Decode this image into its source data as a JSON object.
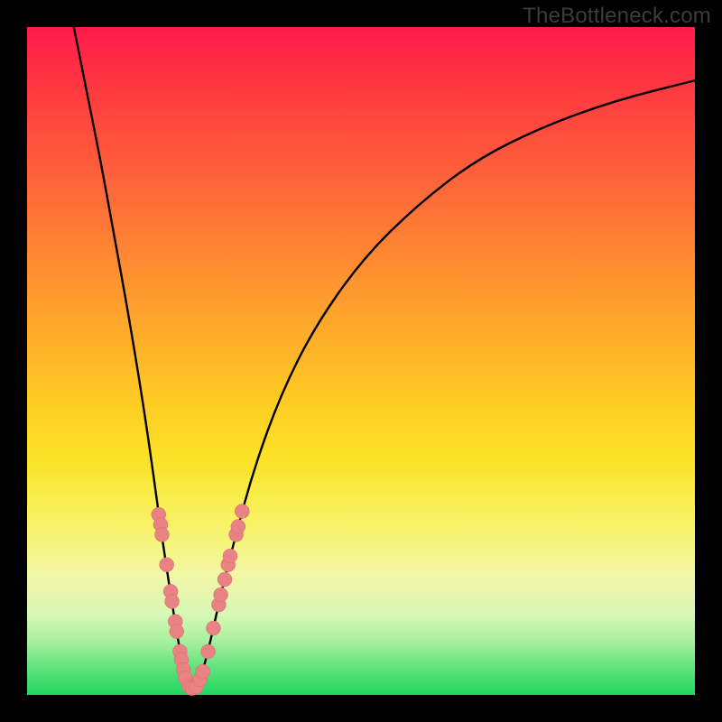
{
  "watermark": "TheBottleneck.com",
  "colors": {
    "frame": "#000000",
    "curve": "#000000",
    "marker_fill": "#e98282",
    "marker_stroke": "#d86b6b"
  },
  "chart_data": {
    "type": "line",
    "title": "",
    "xlabel": "",
    "ylabel": "",
    "xlim": [
      0,
      100
    ],
    "ylim": [
      0,
      100
    ],
    "note": "V-shaped bottleneck curve with vertex near x≈24, y≈0; gradient background red(top)→green(bottom); curve enters top-left corner and exits mid-right edge",
    "curve_points": [
      {
        "x": 7.0,
        "y": 100.0
      },
      {
        "x": 9.0,
        "y": 90.0
      },
      {
        "x": 11.0,
        "y": 80.0
      },
      {
        "x": 13.0,
        "y": 69.0
      },
      {
        "x": 15.0,
        "y": 58.0
      },
      {
        "x": 17.0,
        "y": 46.0
      },
      {
        "x": 18.5,
        "y": 36.0
      },
      {
        "x": 20.0,
        "y": 25.0
      },
      {
        "x": 21.5,
        "y": 15.0
      },
      {
        "x": 22.8,
        "y": 7.0
      },
      {
        "x": 24.0,
        "y": 1.0
      },
      {
        "x": 25.5,
        "y": 1.0
      },
      {
        "x": 27.0,
        "y": 6.0
      },
      {
        "x": 29.0,
        "y": 15.0
      },
      {
        "x": 31.0,
        "y": 23.0
      },
      {
        "x": 34.0,
        "y": 34.0
      },
      {
        "x": 38.0,
        "y": 45.0
      },
      {
        "x": 43.0,
        "y": 55.0
      },
      {
        "x": 50.0,
        "y": 65.0
      },
      {
        "x": 58.0,
        "y": 73.0
      },
      {
        "x": 67.0,
        "y": 80.0
      },
      {
        "x": 77.0,
        "y": 85.0
      },
      {
        "x": 88.0,
        "y": 89.0
      },
      {
        "x": 100.0,
        "y": 92.0
      }
    ],
    "markers": [
      {
        "x": 19.7,
        "y": 27.0
      },
      {
        "x": 20.0,
        "y": 25.5
      },
      {
        "x": 20.2,
        "y": 24.0
      },
      {
        "x": 20.9,
        "y": 19.5
      },
      {
        "x": 21.5,
        "y": 15.5
      },
      {
        "x": 21.7,
        "y": 14.0
      },
      {
        "x": 22.2,
        "y": 11.0
      },
      {
        "x": 22.4,
        "y": 9.5
      },
      {
        "x": 22.9,
        "y": 6.5
      },
      {
        "x": 23.1,
        "y": 5.3
      },
      {
        "x": 23.4,
        "y": 3.8
      },
      {
        "x": 23.7,
        "y": 2.5
      },
      {
        "x": 24.3,
        "y": 1.2
      },
      {
        "x": 24.7,
        "y": 1.0
      },
      {
        "x": 25.3,
        "y": 1.2
      },
      {
        "x": 25.9,
        "y": 2.3
      },
      {
        "x": 26.3,
        "y": 3.5
      },
      {
        "x": 27.1,
        "y": 6.5
      },
      {
        "x": 27.9,
        "y": 10.0
      },
      {
        "x": 28.7,
        "y": 13.5
      },
      {
        "x": 29.0,
        "y": 15.0
      },
      {
        "x": 29.6,
        "y": 17.3
      },
      {
        "x": 30.1,
        "y": 19.5
      },
      {
        "x": 30.4,
        "y": 20.8
      },
      {
        "x": 31.3,
        "y": 24.0
      },
      {
        "x": 31.6,
        "y": 25.2
      },
      {
        "x": 32.2,
        "y": 27.5
      }
    ]
  }
}
